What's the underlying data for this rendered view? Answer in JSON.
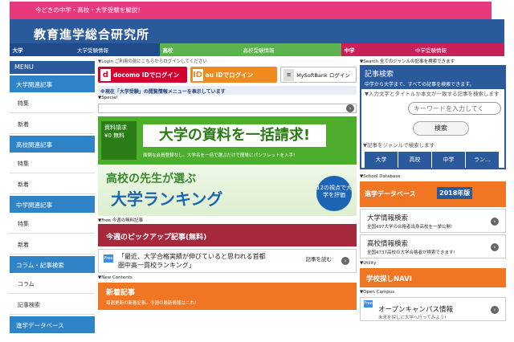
{
  "header": {
    "tagline_prefix": "今どきの",
    "tagline_tags": [
      "中学",
      "高校",
      "大学"
    ],
    "tagline_suffix": "受験を解説！",
    "logo": "教育進学総合研究所"
  },
  "categories": [
    {
      "key": "大学",
      "label": "大学受験情報"
    },
    {
      "key": "高校",
      "label": "高校受験情報"
    },
    {
      "key": "中学",
      "label": "中学受験情報"
    }
  ],
  "sidebar": {
    "menu_label": "MENU",
    "sections": [
      {
        "heading": "大学関連記事",
        "items": [
          "特集",
          "新着"
        ]
      },
      {
        "heading": "高校関連記事",
        "items": [
          "特集",
          "新着"
        ]
      },
      {
        "heading": "中学関連記事",
        "items": [
          "特集",
          "新着"
        ]
      },
      {
        "heading": "コラム・記事検索",
        "items": [
          "コラム",
          "記事検索"
        ]
      },
      {
        "heading": "進学データベース",
        "items": []
      }
    ]
  },
  "login": {
    "label": "▼Login ご利用の前にこちらからログインしてください",
    "docomo": "docomo IDでログイン",
    "au": "au IDでログイン",
    "softbank": "MySoftBank ログイン"
  },
  "notice": "※現在「大学受験」の閲覧情報メニューを表示しています",
  "special_label": "▼Special",
  "banner1": {
    "badge": "資料請求 ¥0 無料",
    "headline": "大学の資料を一括請求!",
    "sub": "面倒な会員登録なし。大学名を一括で選ぶだけで簡単にパンフレットを入手!"
  },
  "banner2": {
    "line1": "高校の先生が選ぶ",
    "line2": "大学ランキング",
    "circle": "12の視点で大学を評価"
  },
  "free_label": "▼Free 今週の無料記事",
  "pickup": {
    "heading": "今週のピックアップ記事(無料)",
    "tag": "Free",
    "text": "「最近、大学合格実績が伸びていると思われる首都圏中高一貫校ランキング」",
    "read": "記事を読む"
  },
  "new_label": "▼New Contents",
  "new_contents": {
    "heading": "新着記事",
    "sub": "毎週更新の新着記事。今週の最新情報はこれ!"
  },
  "search": {
    "label": "▼Search 全てのジャンルの記事を検索できます",
    "heading": "記事検索",
    "sub": "中学から大学まで、すべての記事を検索できます。",
    "hint": "▼入力文字とタイトルか本文が一致する記事を検索します",
    "placeholder": "キーワードを入力してく",
    "button": "検索",
    "genre_label": "▼記事をジャンルで検索します",
    "genres": [
      "大学",
      "高校",
      "中学",
      "ラン…"
    ]
  },
  "database": {
    "label": "▼School Database",
    "heading": "進学データベース",
    "year": "2018年版",
    "items": [
      {
        "title": "大学情報検索",
        "sub": "全国497大学の合格者出身高校を一挙公開!"
      },
      {
        "title": "高校情報検索",
        "sub": "全国4737高校の大学合格者が検索できます!"
      }
    ]
  },
  "utility": {
    "label": "▼Utility",
    "button": "学校探しNAVI"
  },
  "open_campus": {
    "label": "▼Open Campus",
    "tag": "Free",
    "title": "オープンキャンパス情報",
    "sub": "未来を探しに大学へ行ってみよう!"
  }
}
